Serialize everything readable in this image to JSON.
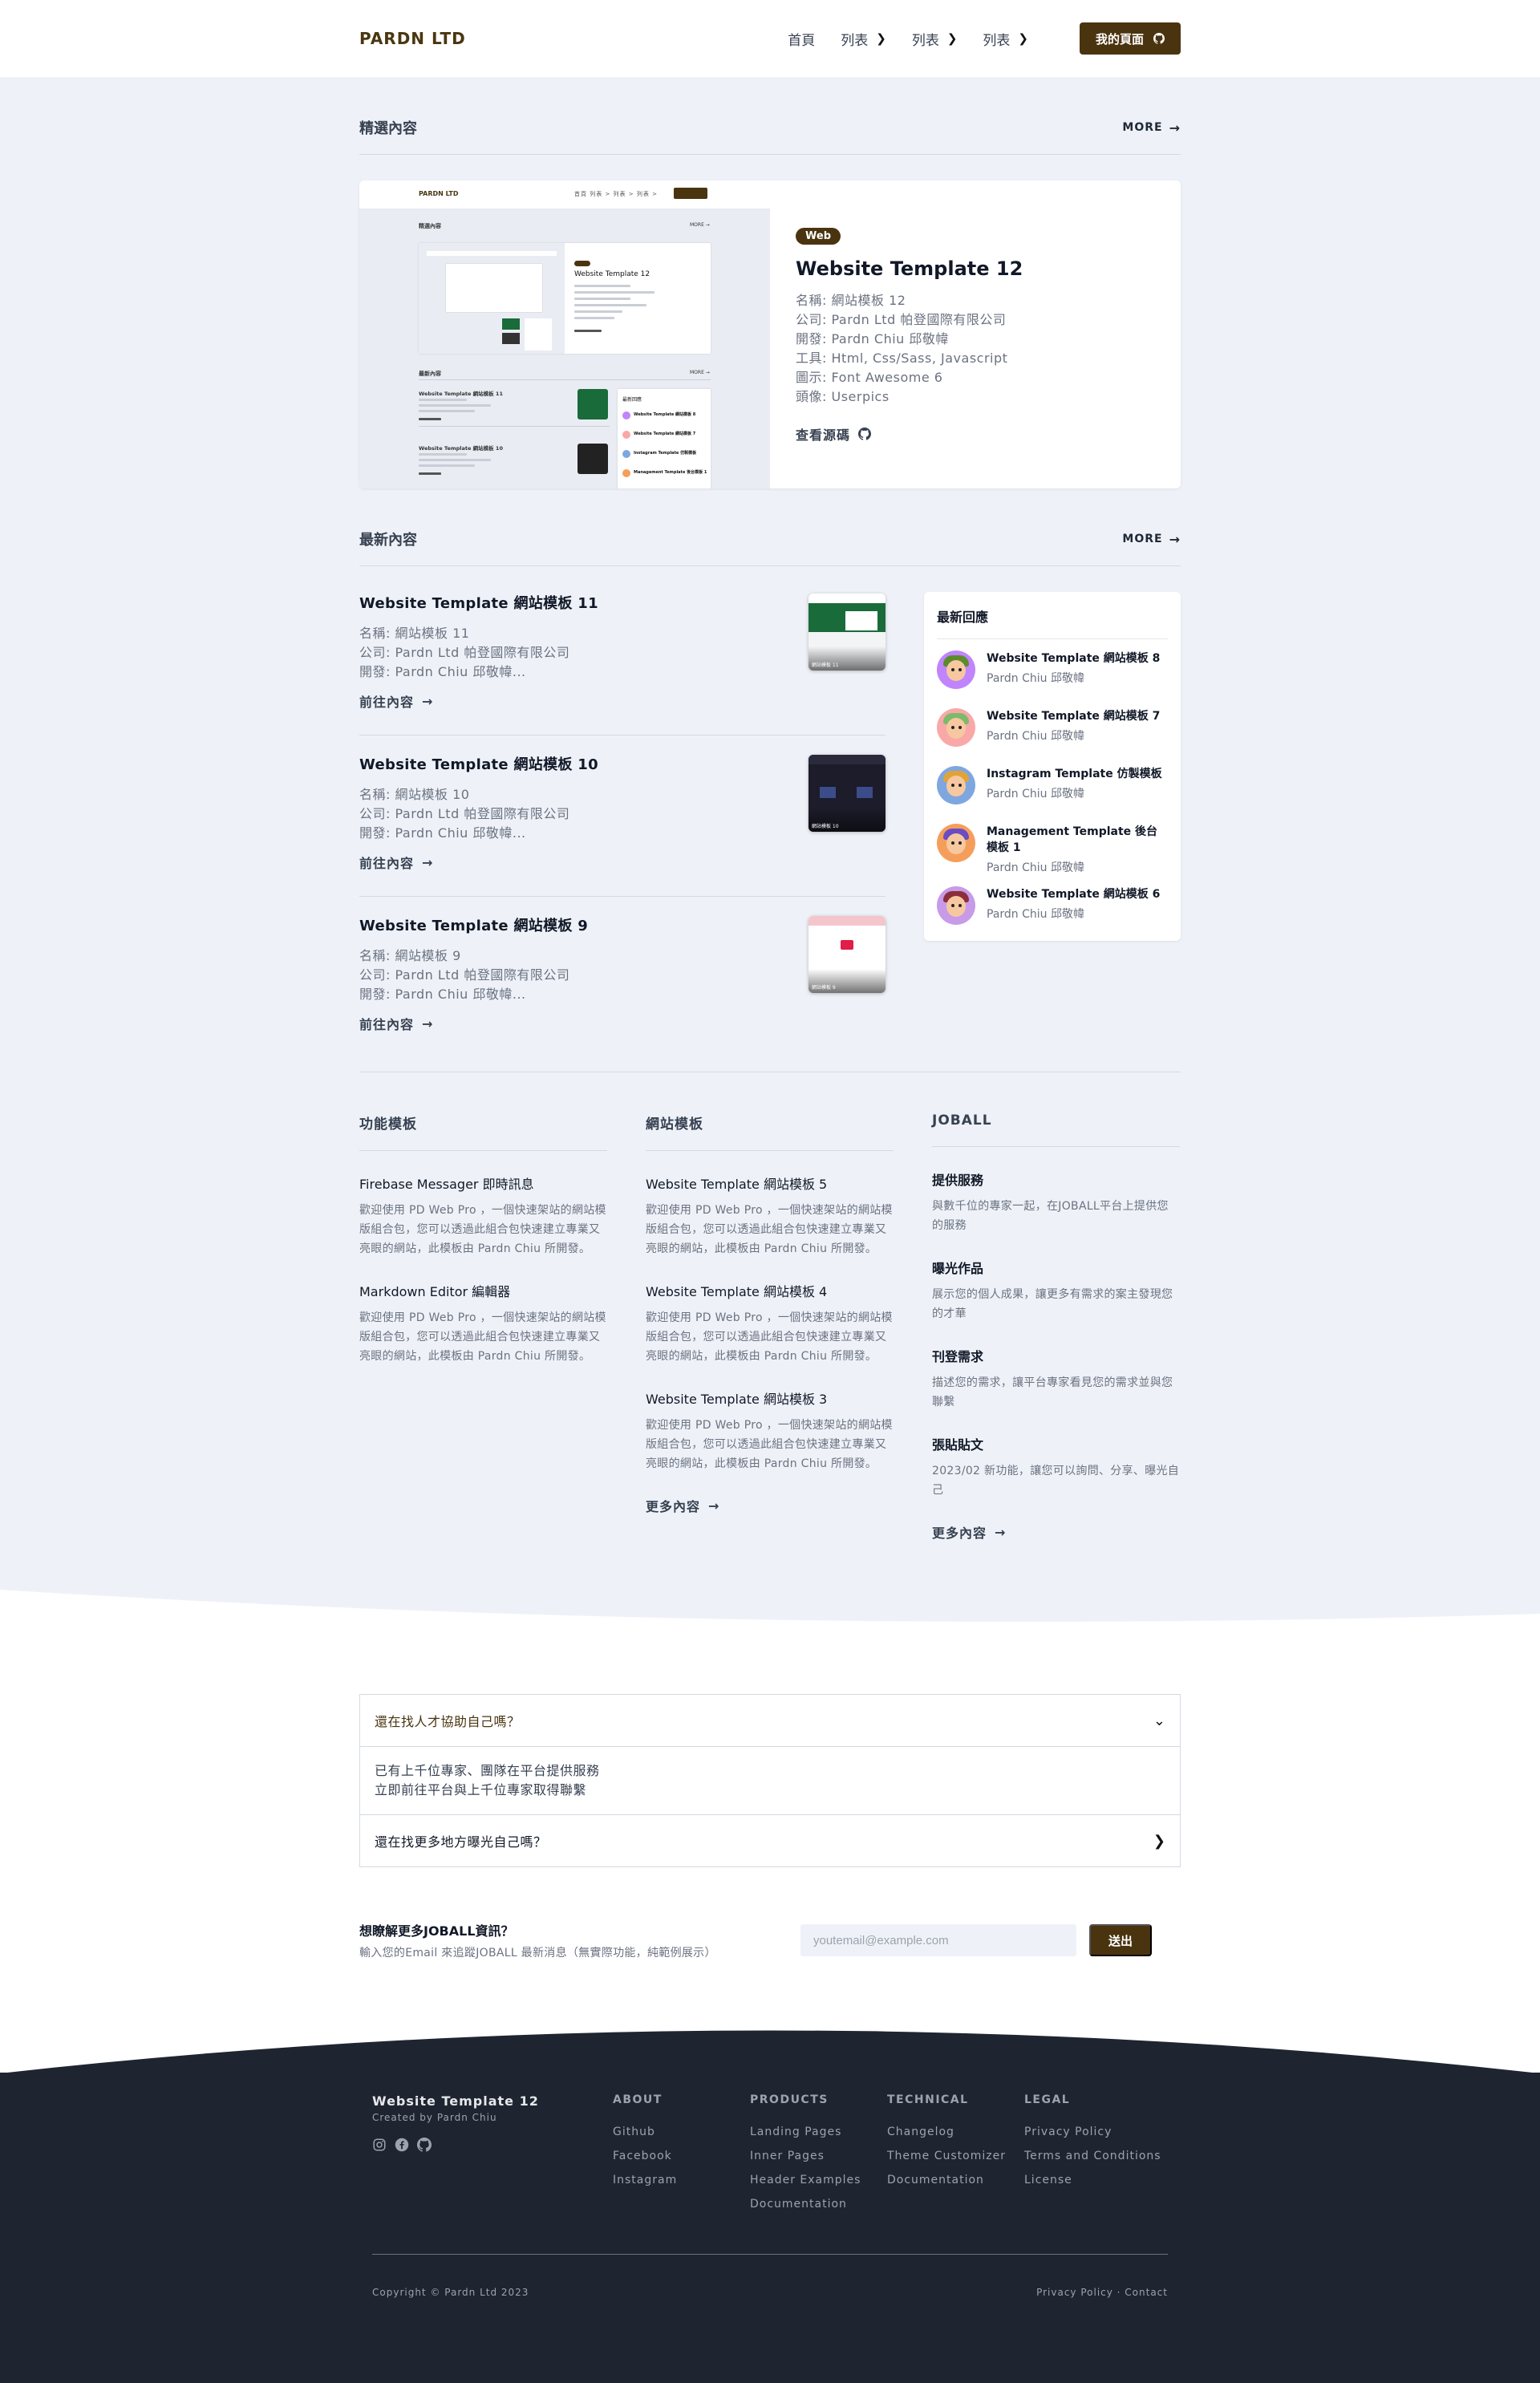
{
  "header": {
    "brand": "PARDN LTD",
    "nav": [
      {
        "label": "首頁",
        "chevron": false
      },
      {
        "label": "列表",
        "chevron": true
      },
      {
        "label": "列表",
        "chevron": true
      },
      {
        "label": "列表",
        "chevron": true
      }
    ],
    "my_page_label": "我的頁面"
  },
  "featured": {
    "section_title": "精選內容",
    "more_label": "MORE",
    "badge": "Web",
    "title": "Website Template 12",
    "meta": [
      "名稱: 網站模板 12",
      "公司: Pardn Ltd 帕登國際有限公司",
      "開發: Pardn Chiu 邱敬幃",
      "工具: Html, Css/Sass, Javascript",
      "圖示: Font Awesome 6",
      "頭像: Userpics"
    ],
    "source_label": "查看源碼",
    "thumb": {
      "brand": "PARDN LTD",
      "nav": "首頁  列表 >  列表 >  列表 >",
      "sec1": "精選內容",
      "sec2": "最新內容",
      "more": "MORE →",
      "card_title": "Website Template 12",
      "card_badge": "Web",
      "list1": "Website Template 網站模板 11",
      "list2": "Website Template 網站模板 10",
      "replies": "最新回應",
      "r1": "Website Template 網站模板 8",
      "r2": "Website Template 網站模板 7",
      "r3": "Instagram Template 仿製模板",
      "r4": "Management Template 後台模板 1"
    }
  },
  "latest": {
    "section_title": "最新內容",
    "more_label": "MORE",
    "items": [
      {
        "title": "Website Template 網站模板 11",
        "meta": [
          "名稱: 網站模板 11",
          "公司: Pardn Ltd 帕登國際有限公司",
          "開發: Pardn Chiu 邱敬幃..."
        ],
        "link": "前往內容",
        "thumb_caption": "網站模板 11"
      },
      {
        "title": "Website Template 網站模板 10",
        "meta": [
          "名稱: 網站模板 10",
          "公司: Pardn Ltd 帕登國際有限公司",
          "開發: Pardn Chiu 邱敬幃..."
        ],
        "link": "前往內容",
        "thumb_caption": "網站模板 10"
      },
      {
        "title": "Website Template 網站模板 9",
        "meta": [
          "名稱: 網站模板 9",
          "公司: Pardn Ltd 帕登國際有限公司",
          "開發: Pardn Chiu 邱敬幃..."
        ],
        "link": "前往內容",
        "thumb_caption": "網站模板 9"
      }
    ]
  },
  "replies": {
    "title": "最新回應",
    "items": [
      {
        "name": "Website Template 網站模板 8",
        "author": "Pardn Chiu 邱敬幃",
        "bg": "#c084fc",
        "hair": "#5b8c2a"
      },
      {
        "name": "Website Template 網站模板 7",
        "author": "Pardn Chiu 邱敬幃",
        "bg": "#f9a8a8",
        "hair": "#7cba6a"
      },
      {
        "name": "Instagram Template 仿製模板",
        "author": "Pardn Chiu 邱敬幃",
        "bg": "#7ea7e0",
        "hair": "#e0a33a"
      },
      {
        "name": "Management Template 後台模板 1",
        "author": "Pardn Chiu 邱敬幃",
        "bg": "#f59e5b",
        "hair": "#6b4cc2"
      },
      {
        "name": "Website Template 網站模板 6",
        "author": "Pardn Chiu 邱敬幃",
        "bg": "#c79be8",
        "hair": "#8b2f3c"
      }
    ]
  },
  "columns": {
    "feature": {
      "title": "功能模板",
      "items": [
        {
          "title": "Firebase Messager 即時訊息",
          "desc": "歡迎使用 PD Web Pro ，一個快速架站的網站模版組合包，您可以透過此組合包快速建立專業又亮眼的網站，此模板由 Pardn Chiu 所開發。"
        },
        {
          "title": "Markdown Editor 編輯器",
          "desc": "歡迎使用 PD Web Pro ，一個快速架站的網站模版組合包，您可以透過此組合包快速建立專業又亮眼的網站，此模板由 Pardn Chiu 所開發。"
        }
      ]
    },
    "website": {
      "title": "網站模板",
      "items": [
        {
          "title": "Website Template 網站模板 5",
          "desc": "歡迎使用 PD Web Pro ，一個快速架站的網站模版組合包，您可以透過此組合包快速建立專業又亮眼的網站，此模板由 Pardn Chiu 所開發。"
        },
        {
          "title": "Website Template 網站模板 4",
          "desc": "歡迎使用 PD Web Pro ，一個快速架站的網站模版組合包，您可以透過此組合包快速建立專業又亮眼的網站，此模板由 Pardn Chiu 所開發。"
        },
        {
          "title": "Website Template 網站模板 3",
          "desc": "歡迎使用 PD Web Pro ，一個快速架站的網站模版組合包，您可以透過此組合包快速建立專業又亮眼的網站，此模板由 Pardn Chiu 所開發。"
        }
      ],
      "more": "更多內容"
    },
    "joball": {
      "title": "JOBALL",
      "items": [
        {
          "title": "提供服務",
          "desc": "與數千位的專家一起，在JOBALL平台上提供您的服務"
        },
        {
          "title": "曝光作品",
          "desc": "展示您的個人成果，讓更多有需求的案主發現您的才華"
        },
        {
          "title": "刊登需求",
          "desc": "描述您的需求，讓平台專家看見您的需求並與您聯繫"
        },
        {
          "title": "張貼貼文",
          "desc": "2023/02 新功能，讓您可以詢問、分享、曝光自己"
        }
      ],
      "more": "更多內容"
    }
  },
  "faq": {
    "q1": "還在找人才協助自己嗎？",
    "a1_line1": "已有上千位專家、團隊在平台提供服務",
    "a1_line2": "立即前往平台與上千位專家取得聯繫",
    "q2": "還在找更多地方曝光自己嗎？"
  },
  "newsletter": {
    "title": "想瞭解更多JOBALL資訊？",
    "subtitle": "輸入您的Email 來追蹤JOBALL 最新消息（無實際功能，純範例展示）",
    "placeholder": "youtemail@example.com",
    "button": "送出"
  },
  "footer": {
    "name": "Website Template 12",
    "created_by": "Created by Pardn Chiu",
    "columns": [
      {
        "title": "ABOUT",
        "links": [
          "Github",
          "Facebook",
          "Instagram"
        ]
      },
      {
        "title": "PRODUCTS",
        "links": [
          "Landing Pages",
          "Inner Pages",
          "Header Examples",
          "Documentation"
        ]
      },
      {
        "title": "TECHNICAL",
        "links": [
          "Changelog",
          "Theme Customizer",
          "Documentation"
        ]
      },
      {
        "title": "LEGAL",
        "links": [
          "Privacy Policy",
          "Terms and Conditions",
          "License"
        ]
      }
    ],
    "copyright": "Copyright © Pardn Ltd 2023",
    "bottom_links": "Privacy Policy · Contact"
  },
  "colors": {
    "brand": "#4a3410",
    "page_bg": "#eef2f8",
    "footer_bg": "#1f2530"
  }
}
